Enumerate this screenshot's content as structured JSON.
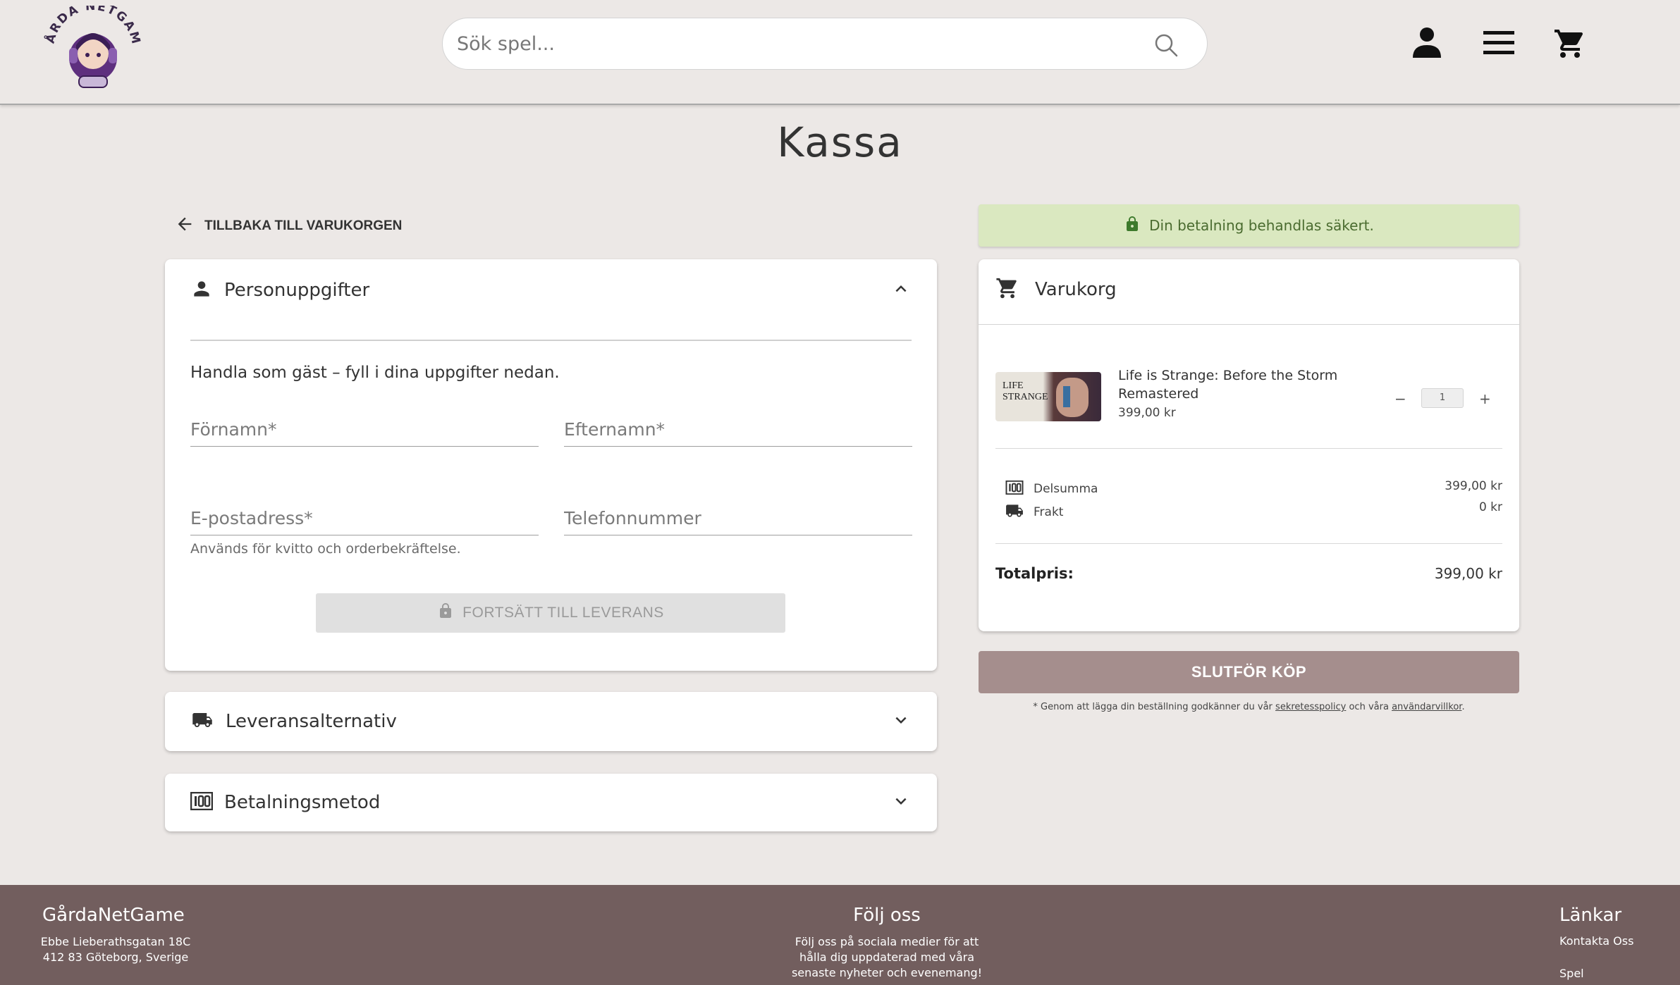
{
  "header": {
    "logo_text": "GÅRDA NETGAME",
    "search_placeholder": "Sök spel...",
    "icons": [
      "search-icon",
      "account-icon",
      "menu-icon",
      "cart-icon"
    ]
  },
  "page": {
    "title": "Kassa",
    "back_label": "TILLBAKA TILL VARUKORGEN"
  },
  "personal": {
    "title": "Personuppgifter",
    "guest_text": "Handla som gäst – fyll i dina uppgifter nedan.",
    "first_name_placeholder": "Förnamn*",
    "last_name_placeholder": "Efternamn*",
    "email_placeholder": "E-postadress*",
    "phone_placeholder": "Telefonnummer",
    "email_helper": "Används för kvitto och orderbekräftelse.",
    "continue_label": "FORTSÄTT TILL LEVERANS"
  },
  "delivery": {
    "title": "Leveransalternativ"
  },
  "payment": {
    "title": "Betalningsmetod"
  },
  "secure_notice": "Din betalning behandlas säkert.",
  "cart": {
    "title": "Varukorg",
    "item": {
      "name": "Life is Strange: Before the Storm Remastered",
      "price": "399,00 kr",
      "quantity": "1",
      "thumb_text_1": "LIFE",
      "thumb_text_2": "STRANGE"
    },
    "subtotal_label": "Delsumma",
    "subtotal_value": "399,00 kr",
    "shipping_label": "Frakt",
    "shipping_value": "0 kr",
    "total_label": "Totalpris:",
    "total_value": "399,00 kr"
  },
  "buy_label": "SLUTFÖR KÖP",
  "terms": {
    "prefix": "* Genom att lägga din beställning godkänner du vår",
    "privacy": "sekretesspolicy",
    "middle": "och våra",
    "conditions": "användarvillkor",
    "suffix": "."
  },
  "footer": {
    "brand": "GårdaNetGame",
    "address_1": "Ebbe Lieberathsgatan 18C",
    "address_2": "412 83 Göteborg, Sverige",
    "follow_title": "Följ oss",
    "follow_1": "Följ oss på sociala medier för att",
    "follow_2": "hålla dig uppdaterad med våra",
    "follow_3": "senaste nyheter och evenemang!",
    "links_title": "Länkar",
    "link_1": "Kontakta Oss",
    "link_2": "Spel"
  },
  "colors": {
    "background": "#ece8e6",
    "secure_bg": "#dae8c0",
    "buy_button": "#a58e8d",
    "footer": "#725e5e"
  }
}
